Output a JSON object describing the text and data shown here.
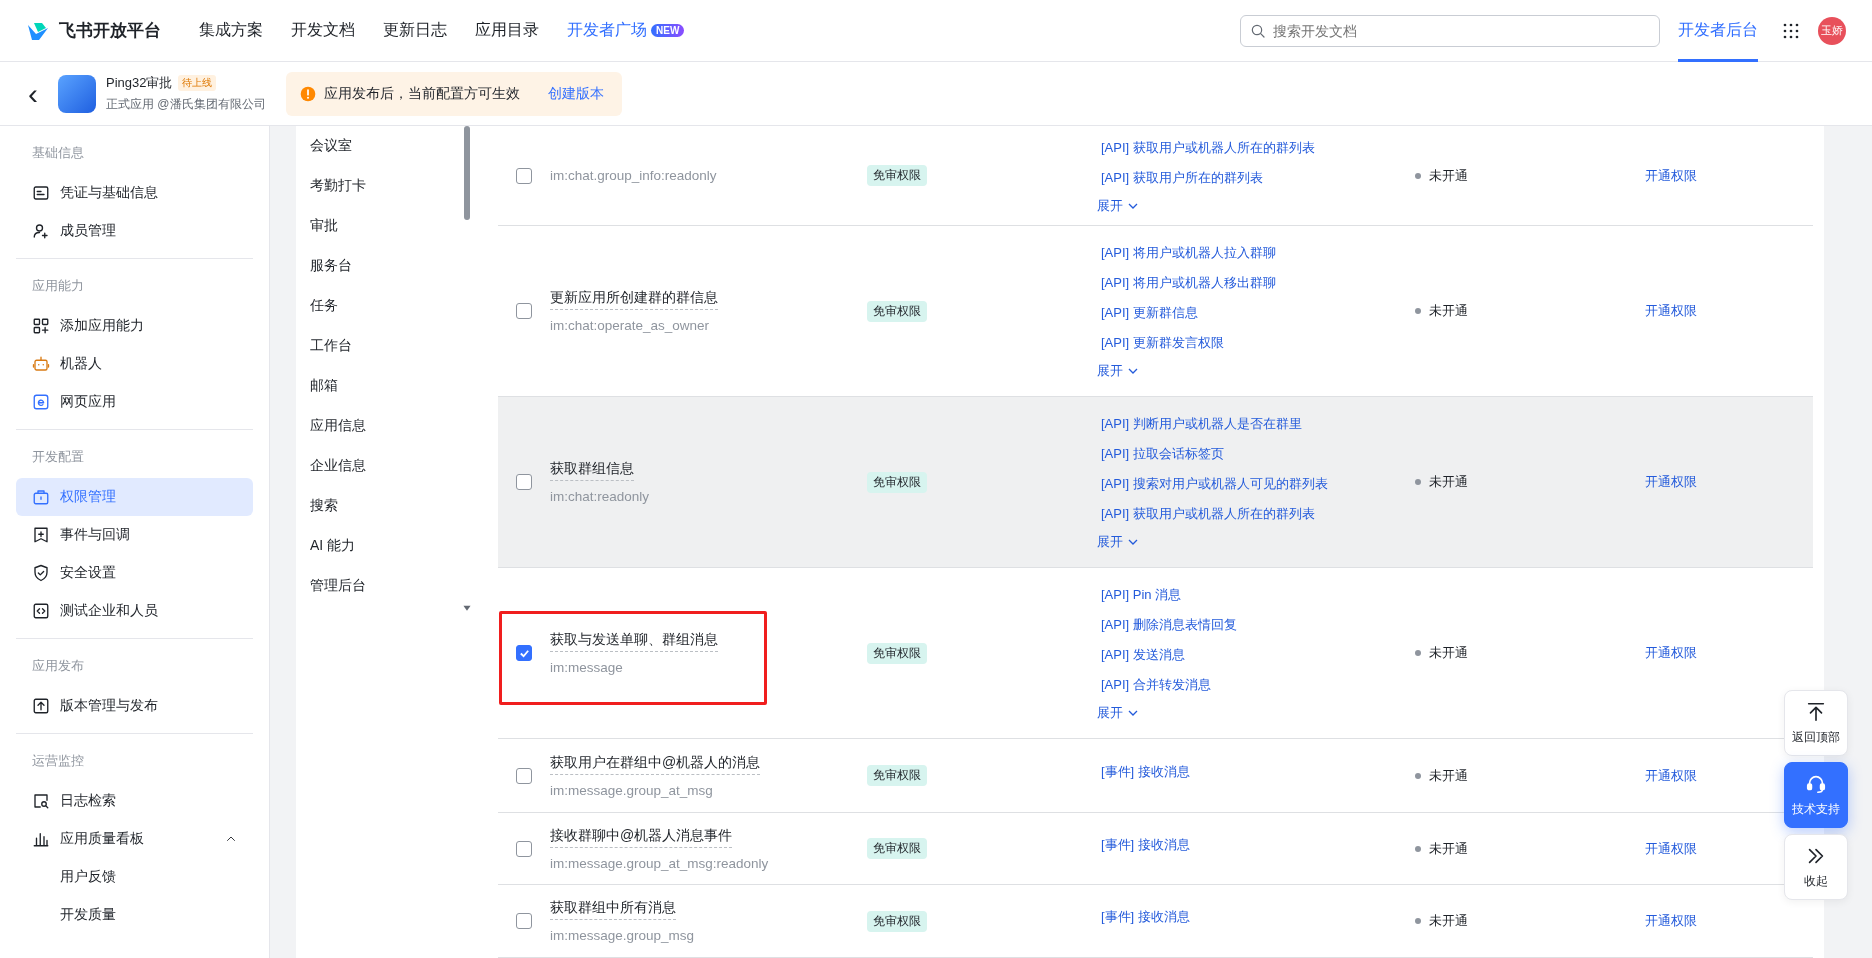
{
  "header": {
    "logo_text": "飞书开放平台",
    "nav": [
      {
        "label": "集成方案",
        "highlighted": false
      },
      {
        "label": "开发文档",
        "highlighted": false
      },
      {
        "label": "更新日志",
        "highlighted": false
      },
      {
        "label": "应用目录",
        "highlighted": false
      },
      {
        "label": "开发者广场",
        "highlighted": true,
        "badge": "NEW"
      }
    ],
    "search": {
      "placeholder": "搜索开发文档"
    },
    "console_tab": {
      "label": "开发者后台",
      "selected": true
    },
    "avatar_text": "玉娇"
  },
  "app_bar": {
    "back": "‹",
    "app_name": "Ping32审批",
    "status_tag": "待上线",
    "app_meta": "正式应用 @潘氏集团有限公司",
    "notice": {
      "text": "应用发布后，当前配置方可生效",
      "link": "创建版本"
    }
  },
  "sidebar": {
    "groups": [
      {
        "title": "基础信息",
        "items": [
          {
            "label": "凭证与基础信息",
            "selected": false
          },
          {
            "label": "成员管理",
            "selected": false
          }
        ]
      },
      {
        "title": "应用能力",
        "items": [
          {
            "label": "添加应用能力",
            "selected": false
          },
          {
            "label": "机器人",
            "selected": false
          },
          {
            "label": "网页应用",
            "selected": false
          }
        ]
      },
      {
        "title": "开发配置",
        "items": [
          {
            "label": "权限管理",
            "selected": true
          },
          {
            "label": "事件与回调",
            "selected": false
          },
          {
            "label": "安全设置",
            "selected": false
          },
          {
            "label": "测试企业和人员",
            "selected": false
          }
        ]
      },
      {
        "title": "应用发布",
        "items": [
          {
            "label": "版本管理与发布",
            "selected": false
          }
        ]
      },
      {
        "title": "运营监控",
        "items": [
          {
            "label": "日志检索",
            "selected": false
          },
          {
            "label": "应用质量看板",
            "selected": false,
            "expanded": true,
            "children": [
              {
                "label": "用户反馈",
                "selected": false
              },
              {
                "label": "开发质量",
                "selected": false
              }
            ]
          }
        ]
      }
    ]
  },
  "categories": [
    "会议室",
    "考勤打卡",
    "审批",
    "服务台",
    "任务",
    "工作台",
    "邮箱",
    "应用信息",
    "企业信息",
    "搜索",
    "AI 能力",
    "管理后台"
  ],
  "permissions": [
    {
      "scope": "im:chat.group_info:readonly",
      "badge": "免审权限",
      "apis": [
        "[API] 获取用户或机器人所在的群列表",
        "[API] 获取用户所在的群列表"
      ],
      "expand": "展开",
      "status": "未开通",
      "action": "开通权限",
      "checked": false,
      "hovered": false,
      "highlighted": false
    },
    {
      "title": "更新应用所创建群的群信息",
      "scope": "im:chat:operate_as_owner",
      "badge": "免审权限",
      "apis": [
        "[API] 将用户或机器人拉入群聊",
        "[API] 将用户或机器人移出群聊",
        "[API] 更新群信息",
        "[API] 更新群发言权限"
      ],
      "expand": "展开",
      "status": "未开通",
      "action": "开通权限",
      "checked": false,
      "hovered": false,
      "highlighted": false
    },
    {
      "title": "获取群组信息",
      "scope": "im:chat:readonly",
      "badge": "免审权限",
      "apis": [
        "[API] 判断用户或机器人是否在群里",
        "[API] 拉取会话标签页",
        "[API] 搜索对用户或机器人可见的群列表",
        "[API] 获取用户或机器人所在的群列表"
      ],
      "expand": "展开",
      "status": "未开通",
      "action": "开通权限",
      "checked": false,
      "hovered": true,
      "highlighted": false
    },
    {
      "title": "获取与发送单聊、群组消息",
      "scope": "im:message",
      "badge": "免审权限",
      "apis": [
        "[API] Pin 消息",
        "[API] 删除消息表情回复",
        "[API] 发送消息",
        "[API] 合并转发消息"
      ],
      "expand": "展开",
      "status": "未开通",
      "action": "开通权限",
      "checked": true,
      "hovered": false,
      "highlighted": true
    },
    {
      "title": "获取用户在群组中@机器人的消息",
      "scope": "im:message.group_at_msg",
      "badge": "免审权限",
      "apis": [
        "[事件] 接收消息"
      ],
      "status": "未开通",
      "action": "开通权限",
      "checked": false,
      "hovered": false,
      "highlighted": false
    },
    {
      "title": "接收群聊中@机器人消息事件",
      "scope": "im:message.group_at_msg:readonly",
      "badge": "免审权限",
      "apis": [
        "[事件] 接收消息"
      ],
      "status": "未开通",
      "action": "开通权限",
      "checked": false,
      "hovered": false,
      "highlighted": false
    },
    {
      "title": "获取群组中所有消息",
      "scope": "im:message.group_msg",
      "badge": "免审权限",
      "apis": [
        "[事件] 接收消息"
      ],
      "status": "未开通",
      "action": "开通权限",
      "checked": false,
      "hovered": false,
      "highlighted": false
    }
  ],
  "float_buttons": [
    {
      "kind": "top",
      "label": "返回顶部"
    },
    {
      "kind": "support",
      "label": "技术支持"
    },
    {
      "kind": "collapse",
      "label": "收起"
    }
  ]
}
